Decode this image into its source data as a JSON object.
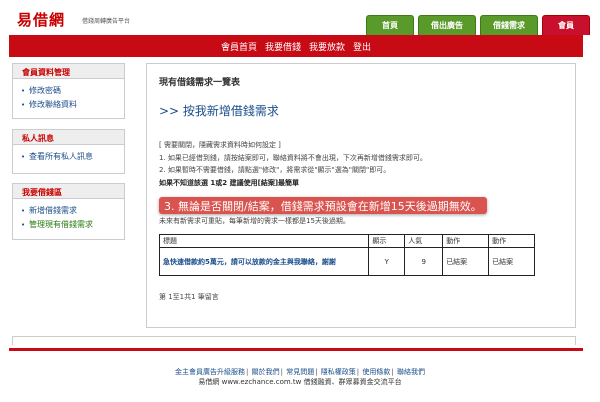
{
  "header": {
    "logo": "易借網",
    "tagline": "借錢周轉廣告平台",
    "tabs": [
      "首頁",
      "借出廣告",
      "借錢需求",
      "會員"
    ]
  },
  "navbar": {
    "items": [
      "會員首頁",
      "我要借錢",
      "我要放款",
      "登出"
    ]
  },
  "sidebar": {
    "member": {
      "title": "會員資料管理",
      "items": [
        "修改密碼",
        "修改聯絡資料"
      ]
    },
    "messages": {
      "title": "私人訊息",
      "items": [
        "查看所有私人訊息"
      ]
    },
    "borrow": {
      "title": "我要借錢區",
      "items": [
        "新增借錢需求",
        "管理現有借錢需求"
      ]
    }
  },
  "main": {
    "title": "現有借錢需求一覽表",
    "add_link": ">> 按我新增借錢需求",
    "notes": [
      "[ 需要關閉，隱藏需求資料時如何設定 ]",
      "1. 如果已經借到錢，請按結案即可，聯絡資料將不會出現，下次再新增借錢需求即可。",
      "2. 如果暫時不需要借錢，請點選\"修改\"，將需求從\"顯示\"選為\"關閉\"即可。"
    ],
    "bold_note": "如果不知道該選 1或2 建議使用[結案]最簡單",
    "highlight": "3. 無論是否關閉/結案，借錢需求預設會在新增15天後過期無效。",
    "notes2": "未來有新需求可重貼，每筆新增的需求一樣都是15天後過期。",
    "table": {
      "headers": [
        "標題",
        "顯示",
        "人氣",
        "動作",
        "動作"
      ],
      "rows": [
        {
          "title": "急快速借款約5萬元，請可以放款的金主與我聯絡，謝謝",
          "display": "Y",
          "popularity": "9",
          "action1": "已結案",
          "action2": "已結案"
        }
      ]
    },
    "pager": "第 1至1共1 筆留言"
  },
  "footer": {
    "links": [
      "金主會員廣告升級服務",
      "關於我們",
      "常見問題",
      "隱私權政策",
      "使用條款",
      "聯絡我們"
    ],
    "line2": "易借網 www.ezchance.com.tw 借錢融資、群眾募資金交流平台"
  },
  "colors": {
    "brand_red": "#c80a14",
    "tab_green": "#5a9a2a",
    "link_blue": "#1a4d8a",
    "highlight_red": "#d9534f"
  }
}
